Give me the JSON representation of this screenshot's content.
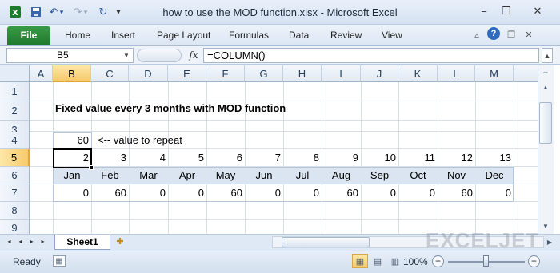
{
  "window": {
    "title": "how to use the MOD function.xlsx - Microsoft Excel",
    "minimize": "−",
    "restore": "❐",
    "close": "✕"
  },
  "quick_access": {
    "save_icon": "💾",
    "undo_icon": "↶",
    "undo_dropdown": "▾",
    "redo_icon": "↷",
    "redo_dropdown": "▾",
    "refresh_icon": "↻",
    "customize_icon": "▾"
  },
  "ribbon": {
    "file_tab": "File",
    "tabs": [
      "Home",
      "Insert",
      "Page Layout",
      "Formulas",
      "Data",
      "Review",
      "View"
    ],
    "minimize_ribbon_icon": "▵",
    "help_icon": "?",
    "restore_icon": "❐",
    "close_icon": "✕"
  },
  "formula_bar": {
    "name_box": "B5",
    "fx_label": "fx",
    "formula": "=COLUMN()"
  },
  "grid": {
    "columns": [
      "A",
      "B",
      "C",
      "D",
      "E",
      "F",
      "G",
      "H",
      "I",
      "J",
      "K",
      "L",
      "M"
    ],
    "rows": [
      "1",
      "2",
      "3",
      "4",
      "5",
      "6",
      "7",
      "8",
      "9"
    ],
    "selected_column": "B",
    "selected_row": "5",
    "selected_cell": "B5",
    "title": "Fixed value every 3 months with MOD function",
    "value_to_repeat": "60",
    "value_note": "<-- value to repeat",
    "column_numbers": [
      "2",
      "3",
      "4",
      "5",
      "6",
      "7",
      "8",
      "9",
      "10",
      "11",
      "12",
      "13"
    ],
    "months": [
      "Jan",
      "Feb",
      "Mar",
      "Apr",
      "May",
      "Jun",
      "Jul",
      "Aug",
      "Sep",
      "Oct",
      "Nov",
      "Dec"
    ],
    "results": [
      "0",
      "60",
      "0",
      "0",
      "60",
      "0",
      "0",
      "60",
      "0",
      "0",
      "60",
      "0"
    ]
  },
  "sheets": {
    "tabs": [
      "Sheet1"
    ],
    "active": "Sheet1",
    "nav_first": "◂",
    "nav_prev": "◂",
    "nav_next": "▸",
    "nav_last": "▸",
    "insert_sheet_icon": "✚"
  },
  "watermark": "EXCELJET",
  "status_bar": {
    "mode": "Ready",
    "zoom": "100%",
    "zoom_value": 100,
    "zoom_out": "−",
    "zoom_in": "+"
  },
  "colors": {
    "file_tab": "#1f7a2d",
    "selection_header": "#f7c96b",
    "band": "#dbe5f1"
  }
}
